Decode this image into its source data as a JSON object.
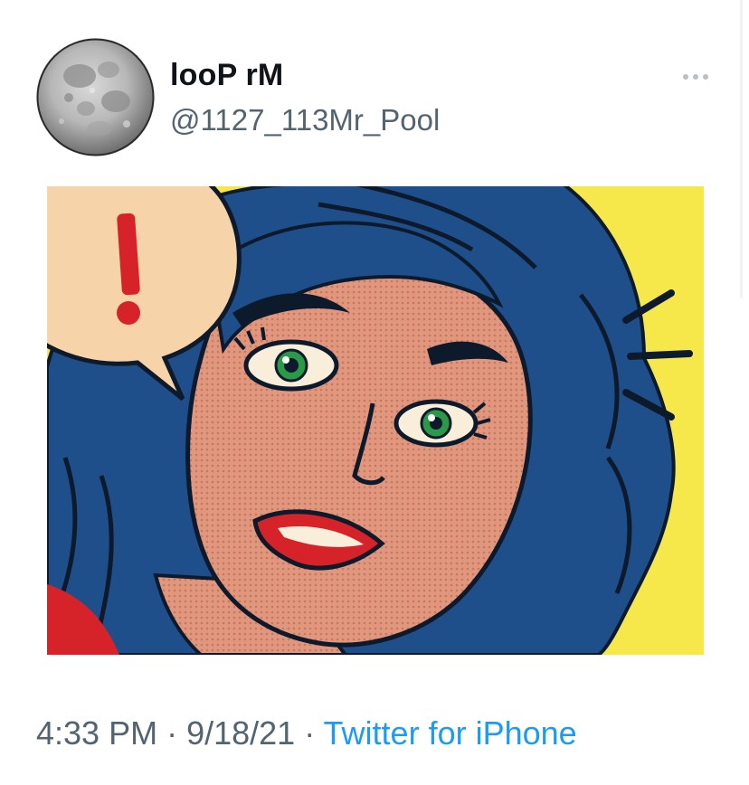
{
  "tweet": {
    "author": {
      "display_name": "looP rM",
      "handle": "@1127_113Mr_Pool",
      "avatar_icon": "moon-avatar"
    },
    "more_icon": "more-options-icon",
    "media": {
      "icon": "pop-art-woman-illustration",
      "exclamation": "!",
      "colors": {
        "background": "#f6e84a",
        "hair": "#1f4f8a",
        "skin": "#e0977e",
        "bubble": "#f6d3a8",
        "lips": "#d6232a",
        "eyes": "#2a9a48"
      }
    },
    "meta": {
      "time": "4:33 PM",
      "separator": " · ",
      "date": "9/18/21",
      "source": "Twitter for iPhone"
    }
  },
  "colors": {
    "name": "#0f1419",
    "secondary_text": "#536471",
    "link": "#1d9bf0"
  }
}
